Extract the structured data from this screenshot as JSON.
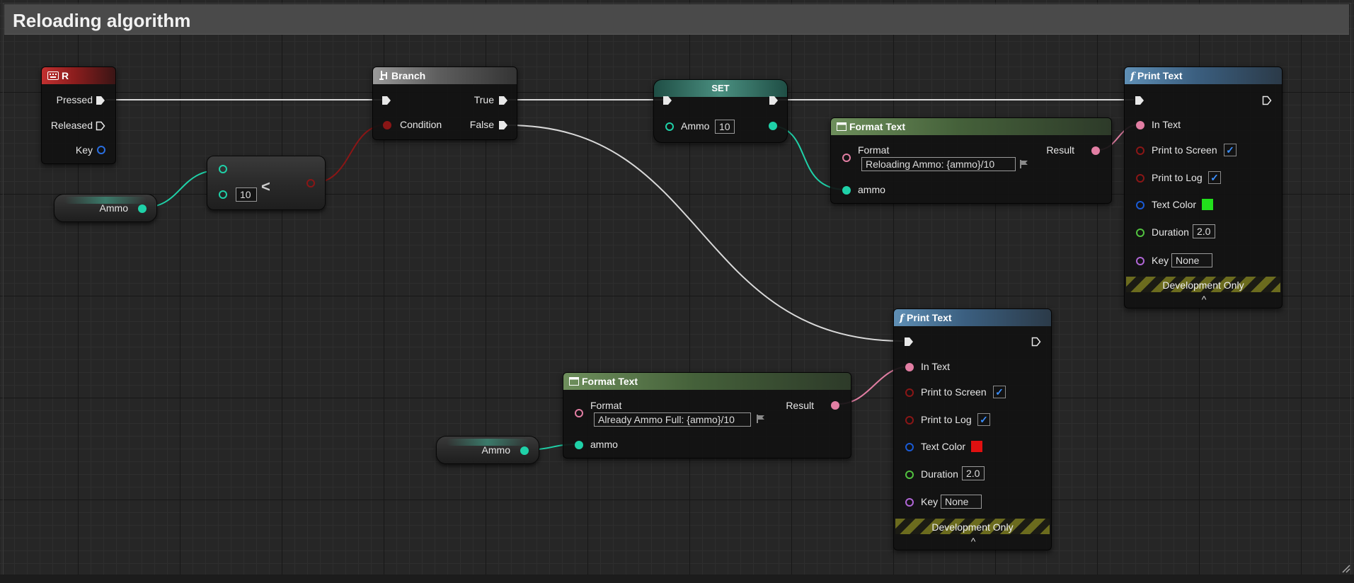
{
  "comment": {
    "title": "Reloading algorithm"
  },
  "colors": {
    "exec": "#e8e8e8",
    "bool": "#8a1616",
    "int": "#1fd1a8",
    "text": "#e27ea3",
    "color": "#1a5bd6",
    "float": "#52c240",
    "name": "#b066d6",
    "key": "#2a6ee0"
  },
  "input_r": {
    "title": "R",
    "icon": "keyboard-icon",
    "pressed": "Pressed",
    "released": "Released",
    "key": "Key"
  },
  "ammo_var_top": {
    "label": "Ammo"
  },
  "less_node": {
    "operator": "<",
    "value": "10"
  },
  "branch": {
    "title": "Branch",
    "icon": "branch-icon",
    "condition": "Condition",
    "true_label": "True",
    "false_label": "False"
  },
  "set_node": {
    "title": "SET",
    "var_label": "Ammo",
    "value": "10"
  },
  "format_top": {
    "title": "Format Text",
    "format_label": "Format",
    "format_value": "Reloading Ammo: {ammo}/10",
    "result": "Result",
    "arg": "ammo"
  },
  "print_top": {
    "title": "Print Text",
    "icon": "function-icon",
    "in_text": "In Text",
    "to_screen": "Print to Screen",
    "to_log": "Print to Log",
    "text_color": "Text Color",
    "text_color_value": "#22e01c",
    "duration": "Duration",
    "duration_value": "2.0",
    "key": "Key",
    "key_value": "None",
    "dev": "Development Only",
    "caret": "^"
  },
  "ammo_var_bottom": {
    "label": "Ammo"
  },
  "format_bottom": {
    "title": "Format Text",
    "format_label": "Format",
    "format_value": "Already Ammo Full: {ammo}/10",
    "result": "Result",
    "arg": "ammo"
  },
  "print_bottom": {
    "title": "Print Text",
    "icon": "function-icon",
    "in_text": "In Text",
    "to_screen": "Print to Screen",
    "to_log": "Print to Log",
    "text_color": "Text Color",
    "text_color_value": "#e01010",
    "duration": "Duration",
    "duration_value": "2.0",
    "key": "Key",
    "key_value": "None",
    "dev": "Development Only",
    "caret": "^"
  }
}
